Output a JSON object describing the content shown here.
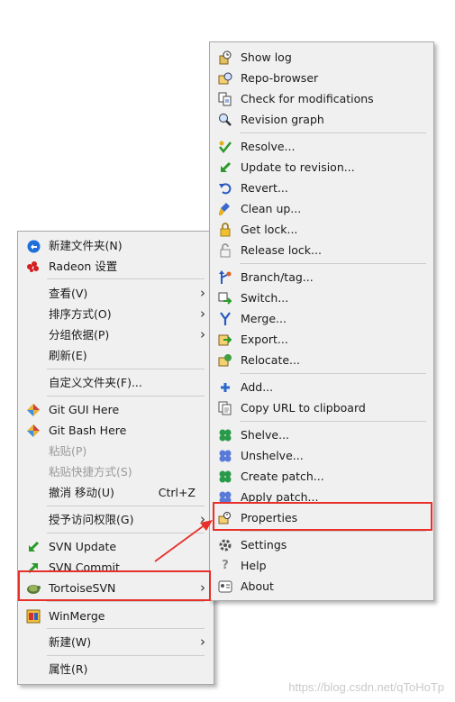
{
  "main_menu": {
    "items": [
      {
        "label": "新建文件夹(N)",
        "icon": "new-folder-icon"
      },
      {
        "label": "Radeon 设置",
        "icon": "radeon-icon"
      },
      {
        "label": "查看(V)"
      },
      {
        "label": "排序方式(O)"
      },
      {
        "label": "分组依据(P)"
      },
      {
        "label": "刷新(E)"
      },
      {
        "label": "自定义文件夹(F)..."
      },
      {
        "label": "Git GUI Here",
        "icon": "git-icon"
      },
      {
        "label": "Git Bash Here",
        "icon": "git-icon"
      },
      {
        "label": "粘贴(P)"
      },
      {
        "label": "粘贴快捷方式(S)"
      },
      {
        "label": "撤消 移动(U)",
        "shortcut": "Ctrl+Z"
      },
      {
        "label": "授予访问权限(G)"
      },
      {
        "label": "SVN Update",
        "icon": "svn-update-icon"
      },
      {
        "label": "SVN Commit",
        "icon": "svn-commit-icon"
      },
      {
        "label": "TortoiseSVN",
        "icon": "tortoisesvn-icon"
      },
      {
        "label": "WinMerge",
        "icon": "winmerge-icon"
      },
      {
        "label": "新建(W)"
      },
      {
        "label": "属性(R)"
      }
    ]
  },
  "svn_menu": {
    "items": [
      {
        "label": "Show log",
        "icon": "show-log-icon"
      },
      {
        "label": "Repo-browser",
        "icon": "repo-browser-icon"
      },
      {
        "label": "Check for modifications",
        "icon": "check-modifications-icon"
      },
      {
        "label": "Revision graph",
        "icon": "revision-graph-icon"
      },
      {
        "label": "Resolve...",
        "icon": "resolve-icon"
      },
      {
        "label": "Update to revision...",
        "icon": "update-to-revision-icon"
      },
      {
        "label": "Revert...",
        "icon": "revert-icon"
      },
      {
        "label": "Clean up...",
        "icon": "clean-up-icon"
      },
      {
        "label": "Get lock...",
        "icon": "get-lock-icon"
      },
      {
        "label": "Release lock...",
        "icon": "release-lock-icon"
      },
      {
        "label": "Branch/tag...",
        "icon": "branch-tag-icon"
      },
      {
        "label": "Switch...",
        "icon": "switch-icon"
      },
      {
        "label": "Merge...",
        "icon": "merge-icon"
      },
      {
        "label": "Export...",
        "icon": "export-icon"
      },
      {
        "label": "Relocate...",
        "icon": "relocate-icon"
      },
      {
        "label": "Add...",
        "icon": "add-icon"
      },
      {
        "label": "Copy URL to clipboard",
        "icon": "copy-url-icon"
      },
      {
        "label": "Shelve...",
        "icon": "shelve-icon"
      },
      {
        "label": "Unshelve...",
        "icon": "unshelve-icon"
      },
      {
        "label": "Create patch...",
        "icon": "create-patch-icon"
      },
      {
        "label": "Apply patch...",
        "icon": "apply-patch-icon"
      },
      {
        "label": "Properties",
        "icon": "properties-icon"
      },
      {
        "label": "Settings",
        "icon": "settings-icon"
      },
      {
        "label": "Help",
        "icon": "help-icon"
      },
      {
        "label": "About",
        "icon": "about-icon"
      }
    ]
  },
  "watermark": "https://blog.csdn.net/qToHoTp",
  "colors": {
    "highlight_border": "#e8302a",
    "arrow": "#e8302a",
    "menu_bg": "#f0f0f0"
  }
}
